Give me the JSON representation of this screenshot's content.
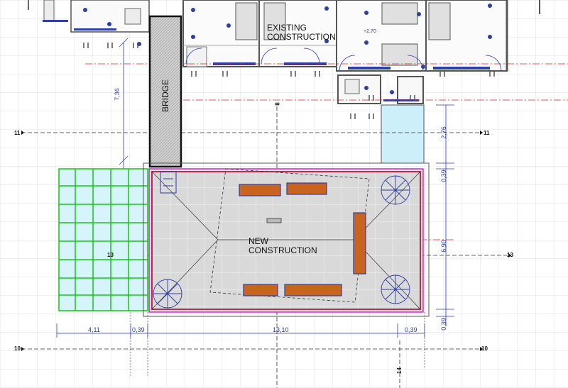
{
  "labels": {
    "existing_line1": "EXISTING",
    "existing_line2": "CONSTRUCTION",
    "new_line1": "NEW",
    "new_line2": "CONSTRUCTION",
    "bridge": "BRIDGE",
    "level_mark": "+2,70"
  },
  "dimensions": {
    "bottom_left": "4,11",
    "bottom_gap_left": "0,39",
    "bottom_main": "13,10",
    "bottom_gap_right": "0,39",
    "right_top": "2,76",
    "right_gap_top": "0,39",
    "right_main": "6,90",
    "right_gap_bottom": "0,39",
    "bridge_length": "7,36"
  },
  "grid_axes": {
    "axis_10": "10",
    "axis_11": "11",
    "axis_13": "13",
    "axis_8": "8",
    "axis_14": "14"
  },
  "colors": {
    "wall": "#444444",
    "annotation_blue": "#2b3fa8",
    "red_axis": "#e02020",
    "pergola_green": "#19c419",
    "glass_blue": "#cdeffa",
    "wood_table": "#c8641e",
    "slab_grey": "#d8d8d8",
    "bridge_grey": "#bdbdbd",
    "magenta_outline": "#c000c0"
  }
}
